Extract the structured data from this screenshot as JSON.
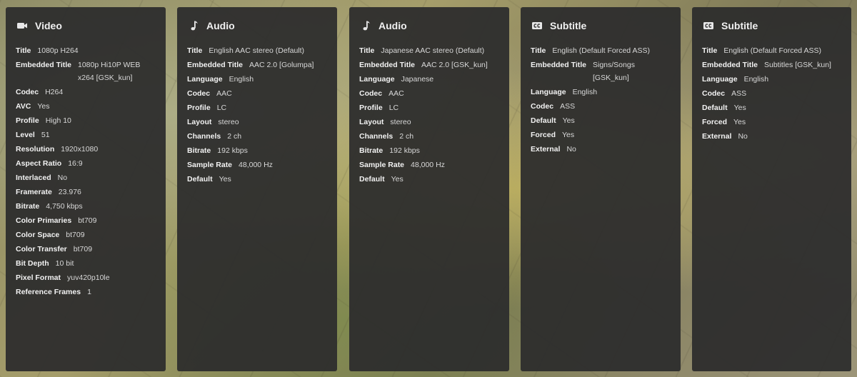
{
  "streams": [
    {
      "type": "Video",
      "icon": "video-camera-icon",
      "fields": [
        {
          "key": "Title",
          "value": "1080p H264"
        },
        {
          "key": "Embedded Title",
          "value": "1080p Hi10P WEB x264 [GSK_kun]"
        },
        {
          "key": "Codec",
          "value": "H264"
        },
        {
          "key": "AVC",
          "value": "Yes"
        },
        {
          "key": "Profile",
          "value": "High 10"
        },
        {
          "key": "Level",
          "value": "51"
        },
        {
          "key": "Resolution",
          "value": "1920x1080"
        },
        {
          "key": "Aspect Ratio",
          "value": "16:9"
        },
        {
          "key": "Interlaced",
          "value": "No"
        },
        {
          "key": "Framerate",
          "value": "23.976"
        },
        {
          "key": "Bitrate",
          "value": "4,750 kbps"
        },
        {
          "key": "Color Primaries",
          "value": "bt709"
        },
        {
          "key": "Color Space",
          "value": "bt709"
        },
        {
          "key": "Color Transfer",
          "value": "bt709"
        },
        {
          "key": "Bit Depth",
          "value": "10 bit"
        },
        {
          "key": "Pixel Format",
          "value": "yuv420p10le"
        },
        {
          "key": "Reference Frames",
          "value": "1"
        }
      ]
    },
    {
      "type": "Audio",
      "icon": "music-note-icon",
      "fields": [
        {
          "key": "Title",
          "value": "English AAC stereo (Default)"
        },
        {
          "key": "Embedded Title",
          "value": "AAC 2.0 [Golumpa]"
        },
        {
          "key": "Language",
          "value": "English"
        },
        {
          "key": "Codec",
          "value": "AAC"
        },
        {
          "key": "Profile",
          "value": "LC"
        },
        {
          "key": "Layout",
          "value": "stereo"
        },
        {
          "key": "Channels",
          "value": "2 ch"
        },
        {
          "key": "Bitrate",
          "value": "192 kbps"
        },
        {
          "key": "Sample Rate",
          "value": "48,000 Hz"
        },
        {
          "key": "Default",
          "value": "Yes"
        }
      ]
    },
    {
      "type": "Audio",
      "icon": "music-note-icon",
      "fields": [
        {
          "key": "Title",
          "value": "Japanese AAC stereo (Default)"
        },
        {
          "key": "Embedded Title",
          "value": "AAC 2.0 [GSK_kun]"
        },
        {
          "key": "Language",
          "value": "Japanese"
        },
        {
          "key": "Codec",
          "value": "AAC"
        },
        {
          "key": "Profile",
          "value": "LC"
        },
        {
          "key": "Layout",
          "value": "stereo"
        },
        {
          "key": "Channels",
          "value": "2 ch"
        },
        {
          "key": "Bitrate",
          "value": "192 kbps"
        },
        {
          "key": "Sample Rate",
          "value": "48,000 Hz"
        },
        {
          "key": "Default",
          "value": "Yes"
        }
      ]
    },
    {
      "type": "Subtitle",
      "icon": "closed-captions-icon",
      "fields": [
        {
          "key": "Title",
          "value": "English (Default Forced ASS)"
        },
        {
          "key": "Embedded Title",
          "value": "Signs/Songs [GSK_kun]"
        },
        {
          "key": "Language",
          "value": "English"
        },
        {
          "key": "Codec",
          "value": "ASS"
        },
        {
          "key": "Default",
          "value": "Yes"
        },
        {
          "key": "Forced",
          "value": "Yes"
        },
        {
          "key": "External",
          "value": "No"
        }
      ]
    },
    {
      "type": "Subtitle",
      "icon": "closed-captions-icon",
      "fields": [
        {
          "key": "Title",
          "value": "English (Default Forced ASS)"
        },
        {
          "key": "Embedded Title",
          "value": "Subtitles [GSK_kun]"
        },
        {
          "key": "Language",
          "value": "English"
        },
        {
          "key": "Codec",
          "value": "ASS"
        },
        {
          "key": "Default",
          "value": "Yes"
        },
        {
          "key": "Forced",
          "value": "Yes"
        },
        {
          "key": "External",
          "value": "No"
        }
      ]
    }
  ]
}
